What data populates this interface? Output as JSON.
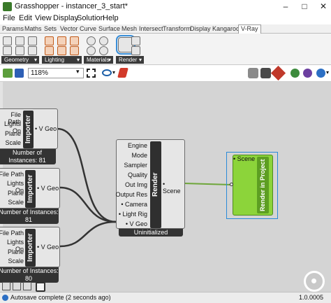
{
  "window": {
    "title": "Grasshopper - instancer_3_start*"
  },
  "menu": [
    "File",
    "Edit",
    "View",
    "Display",
    "Solution",
    "Help"
  ],
  "tabs": [
    "Params",
    "Maths",
    "Sets",
    "Vector",
    "Curve",
    "Surface",
    "Mesh",
    "Intersect",
    "Transform",
    "Display",
    "Kangaroo2",
    "V-Ray"
  ],
  "active_tab": "V-Ray",
  "ribbon_groups": [
    "Geometry",
    "Lighting",
    "Materials",
    "Render"
  ],
  "zoom": "118%",
  "importers": [
    {
      "title": "Importer",
      "inputs": [
        "File Path",
        "Lights On",
        "Plane",
        "Scale"
      ],
      "output": "V Geo",
      "caption": "Number of Instances: 81"
    },
    {
      "title": "Importer",
      "inputs": [
        "File Path",
        "Lights On",
        "Plane",
        "Scale"
      ],
      "output": "V Geo",
      "caption": "Number of Instances: 81"
    },
    {
      "title": "Importer",
      "inputs": [
        "File Path",
        "Lights On",
        "Plane",
        "Scale"
      ],
      "output": "V Geo",
      "caption": "Number of Instances: 80"
    }
  ],
  "render": {
    "title": "Render",
    "inputs": [
      "Engine",
      "Mode",
      "Sampler",
      "Quality",
      "Out Img",
      "Output Res",
      "Camera",
      "Light Rig",
      "V Geo"
    ],
    "output": "Scene",
    "caption": "Uninitialized"
  },
  "render_project": {
    "title": "Render in Project",
    "input": "Scene"
  },
  "status": {
    "text": "Autosave complete (2 seconds ago)",
    "version": "1.0.0005"
  },
  "colors": {
    "render_project_green": "#8cd43a",
    "selection_blue": "#2a8ad8",
    "wire_green": "#6ea63a"
  }
}
